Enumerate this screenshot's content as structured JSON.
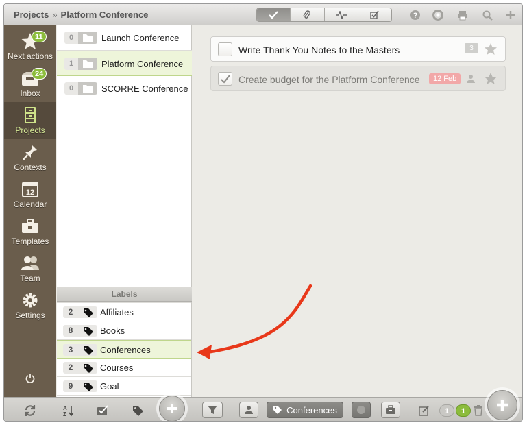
{
  "titlebar": {
    "breadcrumb_root": "Projects",
    "breadcrumb_separator": "»",
    "breadcrumb_current": "Platform Conference",
    "view_tabs": [
      "check-icon",
      "paperclip-icon",
      "activity-icon",
      "checkbox-icon"
    ],
    "right_icons": [
      "help-icon",
      "support-icon",
      "print-icon",
      "search-icon",
      "plus-icon"
    ]
  },
  "sidebar": {
    "items": [
      {
        "label": "Next actions",
        "badge": "11",
        "icon": "star-icon"
      },
      {
        "label": "Inbox",
        "badge": "24",
        "icon": "inbox-icon"
      },
      {
        "label": "Projects",
        "icon": "cabinet-icon"
      },
      {
        "label": "Contexts",
        "icon": "pin-icon"
      },
      {
        "label": "Calendar",
        "icon": "calendar-icon",
        "icon_text": "12"
      },
      {
        "label": "Templates",
        "icon": "toolbox-icon"
      },
      {
        "label": "Team",
        "icon": "team-icon"
      },
      {
        "label": "Settings",
        "icon": "gear-icon"
      }
    ],
    "power_icon": "power-icon"
  },
  "projects": [
    {
      "count": "0",
      "name": "Launch Conference"
    },
    {
      "count": "1",
      "name": "Platform Conference",
      "active": true
    },
    {
      "count": "0",
      "name": "SCORRE Conference"
    }
  ],
  "labels": {
    "header": "Labels",
    "items": [
      {
        "count": "2",
        "name": "Affiliates"
      },
      {
        "count": "8",
        "name": "Books"
      },
      {
        "count": "3",
        "name": "Conferences",
        "active": true
      },
      {
        "count": "2",
        "name": "Courses"
      },
      {
        "count": "9",
        "name": "Goal"
      }
    ]
  },
  "tasks": [
    {
      "title": "Write Thank You Notes to the Masters",
      "comments": "3",
      "done": false
    },
    {
      "title": "Create budget for the Platform Conference",
      "date": "12 Feb",
      "done": true
    }
  ],
  "bottom": {
    "context_filter_label": "Conferences",
    "count_left": "1",
    "count_right": "1"
  },
  "colors": {
    "accent_green": "#8cbc3c",
    "sidebar_bg": "#6a5d4c",
    "active_row": "#eef5da",
    "arrow": "#e8381a",
    "date_badge": "#f2a8a8"
  }
}
